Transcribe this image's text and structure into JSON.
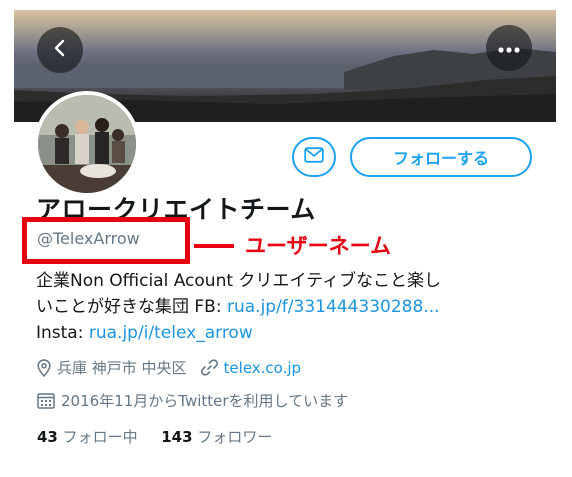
{
  "header": {
    "back_icon": "chevron-left-icon",
    "more_icon": "more-dots-icon"
  },
  "actions": {
    "message_icon": "envelope-icon",
    "follow_label": "フォローする"
  },
  "profile": {
    "display_name": "アロークリエイトチーム",
    "handle": "@TelexArrow",
    "annotation": "ユーザーネーム",
    "bio_line1": "企業Non Official Acount クリエイティブなこと楽し",
    "bio_line2_prefix": "いことが好きな集団 FB: ",
    "bio_fb_link": "rua.jp/f/331444330288...",
    "bio_line3_prefix": "Insta: ",
    "bio_insta_link": "rua.jp/i/telex_arrow",
    "location": "兵庫 神戸市 中央区",
    "website": "telex.co.jp",
    "joined": "2016年11月からTwitterを利用しています",
    "following_count": "43",
    "following_label": "フォロー中",
    "followers_count": "143",
    "followers_label": "フォロワー"
  },
  "colors": {
    "accent": "#1da1f2",
    "link": "#1b95e0",
    "annotation_red": "#e60012",
    "secondary_text": "#657786"
  }
}
